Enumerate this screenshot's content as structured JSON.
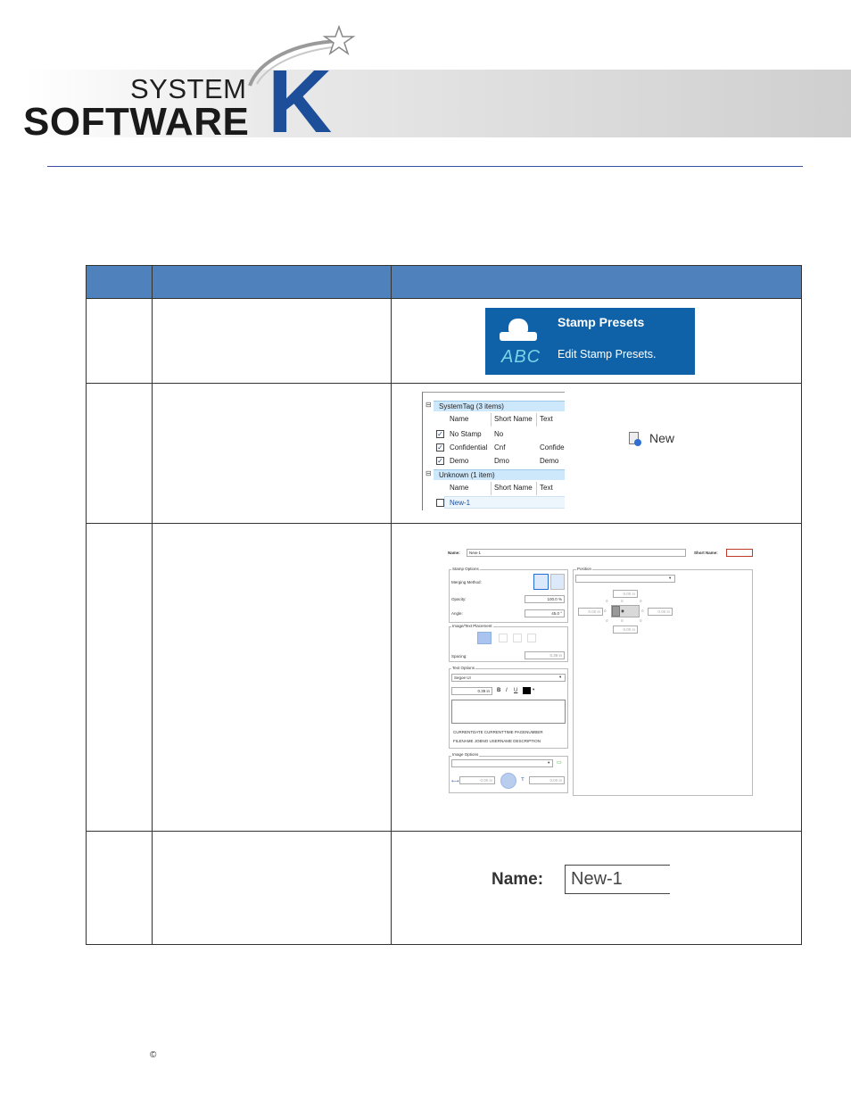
{
  "logo": {
    "line1": "SYSTEM",
    "line2": "SOFTWARE",
    "mark": "K"
  },
  "row1": {
    "stamp_title": "Stamp Presets",
    "stamp_desc": "Edit Stamp Presets.",
    "stamp_abc": "ABC"
  },
  "row2": {
    "group1": "SystemTag (3 items)",
    "group2": "Unknown (1 item)",
    "headers": [
      "Name",
      "Short Name",
      "Text"
    ],
    "items": [
      {
        "name": "No Stamp",
        "short": "No",
        "text": ""
      },
      {
        "name": "Confidential",
        "short": "Cnf",
        "text": "Confide"
      },
      {
        "name": "Demo",
        "short": "Dmo",
        "text": "Demo"
      }
    ],
    "unknown_item": "New-1",
    "new_label": "New"
  },
  "row3": {
    "name_label": "Name:",
    "name_value": "New-1",
    "short_name_label": "Short Name:",
    "stamp_options": "Stamp Options",
    "merging_method": "Merging Method:",
    "opacity_label": "Opacity:",
    "opacity_value": "100.0 %",
    "angle_label": "Angle:",
    "angle_value": "45.0 °",
    "placement": "Image/Text Placement",
    "spacing_label": "Spacing:",
    "spacing_value": "0.39 in",
    "text_options": "Text Options",
    "font": "Segoe UI",
    "font_size": "0.39 in",
    "fmt_b": "B",
    "fmt_i": "I",
    "fmt_u": "U",
    "tokens1": "CURRENTDATE  CURRENTTIME  PAGENUMBER",
    "tokens2": "FILENAME  JOBNO  USERNAME  DESCRIPTION",
    "image_options": "Image Options",
    "img_w": "0.00 in",
    "img_h": "0.00 in",
    "position": "Position",
    "pos_top": "0.00 in",
    "pos_left": "0.00 in",
    "pos_right": "0.00 in",
    "pos_bottom": "0.00 in"
  },
  "row4": {
    "name_label": "Name:",
    "name_value": "New-1"
  },
  "footer": {
    "copyright": "©"
  }
}
